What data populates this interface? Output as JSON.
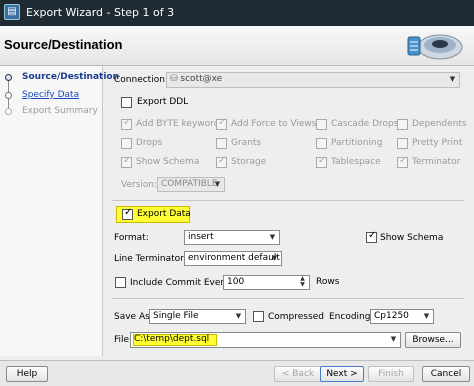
{
  "window": {
    "title": "Export Wizard - Step 1 of 3"
  },
  "header": {
    "title": "Source/Destination"
  },
  "nav": {
    "items": [
      {
        "label": "Source/Destination",
        "state": "current"
      },
      {
        "label": "Specify Data",
        "state": "link"
      },
      {
        "label": "Export Summary",
        "state": "disabled"
      }
    ]
  },
  "connection": {
    "label": "Connection:",
    "value": "scott@xe"
  },
  "export_ddl": {
    "label": "Export DDL",
    "checked": false,
    "options": [
      {
        "label": "Add BYTE keyword",
        "checked": true
      },
      {
        "label": "Add Force to Views",
        "checked": true
      },
      {
        "label": "Cascade Drops",
        "checked": false
      },
      {
        "label": "Dependents",
        "checked": false
      },
      {
        "label": "Drops",
        "checked": false
      },
      {
        "label": "Grants",
        "checked": false
      },
      {
        "label": "Partitioning",
        "checked": false
      },
      {
        "label": "Pretty Print",
        "checked": false
      },
      {
        "label": "Show Schema",
        "checked": true
      },
      {
        "label": "Storage",
        "checked": true
      },
      {
        "label": "Tablespace",
        "checked": true
      },
      {
        "label": "Terminator",
        "checked": true
      }
    ],
    "version_label": "Version:",
    "version_value": "COMPATIBLE"
  },
  "export_data": {
    "label": "Export Data",
    "checked": true,
    "format_label": "Format:",
    "format_value": "insert",
    "show_schema_label": "Show Schema",
    "show_schema_checked": true,
    "line_terminator_label": "Line Terminator:",
    "line_terminator_value": "environment default",
    "include_commit_label": "Include Commit Every",
    "include_commit_checked": false,
    "commit_rows_value": "100",
    "rows_label": "Rows"
  },
  "save": {
    "save_as_label": "Save As",
    "save_as_value": "Single File",
    "compressed_label": "Compressed",
    "compressed_checked": false,
    "encoding_label": "Encoding:",
    "encoding_value": "Cp1250",
    "file_label": "File:",
    "file_value": "C:\\temp\\dept.sql",
    "browse_label": "Browse..."
  },
  "footer": {
    "help": "Help",
    "back": "< Back",
    "next": "Next >",
    "finish": "Finish",
    "cancel": "Cancel"
  }
}
